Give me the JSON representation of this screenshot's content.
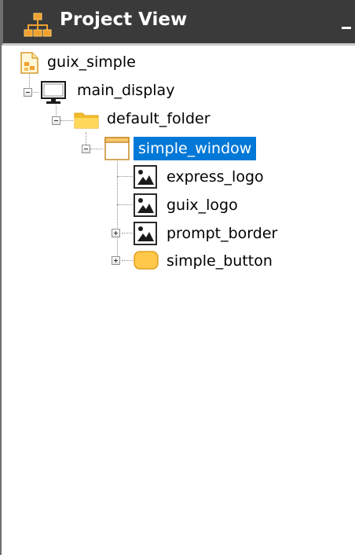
{
  "panel": {
    "title": "Project View",
    "title_icon": "hierarchy-icon",
    "minimize_icon": "minimize-icon",
    "selection_color": "#0078d7"
  },
  "tree": {
    "project": {
      "label": "guix_simple",
      "icon": "project-file-icon"
    },
    "display": {
      "label": "main_display",
      "icon": "monitor-icon",
      "expanded": true
    },
    "folder": {
      "label": "default_folder",
      "icon": "folder-icon",
      "expanded": true
    },
    "window": {
      "label": "simple_window",
      "icon": "window-icon",
      "expanded": true,
      "selected": true
    },
    "children": [
      {
        "label": "express_logo",
        "icon": "image-icon",
        "expandable": false
      },
      {
        "label": "guix_logo",
        "icon": "image-icon",
        "expandable": false
      },
      {
        "label": "prompt_border",
        "icon": "image-icon",
        "expandable": true
      },
      {
        "label": "simple_button",
        "icon": "button-icon",
        "expandable": true
      }
    ]
  }
}
